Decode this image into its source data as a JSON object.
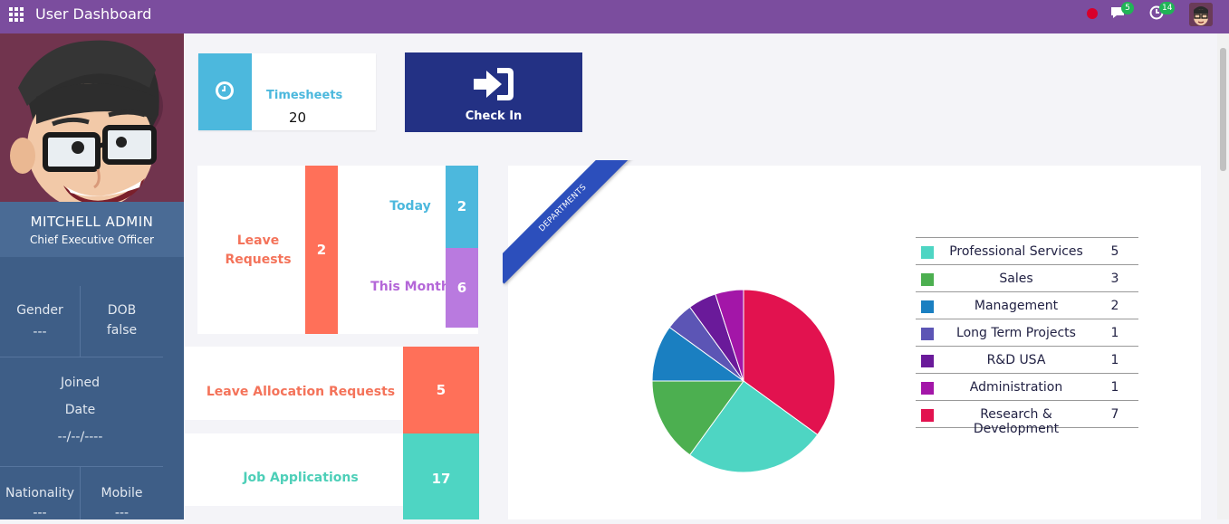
{
  "app": {
    "title": "User Dashboard"
  },
  "topbar": {
    "messages_count": "5",
    "activities_count": "14",
    "colors": {
      "background": "#7b4d9e",
      "badge": "#21b357",
      "status": "#d8002b"
    }
  },
  "profile": {
    "name": "MITCHELL ADMIN",
    "role": "Chief Executive Officer",
    "gender_label": "Gender",
    "gender_value": "---",
    "dob_label": "DOB",
    "dob_value": "false",
    "joined_label": "Joined",
    "date_label": "Date",
    "joined_value": "--/--/----",
    "nationality_label": "Nationality",
    "nationality_value": "---",
    "mobile_label": "Mobile",
    "mobile_value": "---"
  },
  "timesheets": {
    "label": "Timesheets",
    "value": "20"
  },
  "checkin": {
    "label": "Check In"
  },
  "leave_requests": {
    "label": "Leave Requests",
    "value": "2",
    "today_label": "Today",
    "today_value": "2",
    "month_label": "This Month",
    "month_value": "6"
  },
  "allocation": {
    "label": "Leave Allocation Requests",
    "value": "5"
  },
  "jobs": {
    "label": "Job Applications",
    "value": "17"
  },
  "departments": {
    "ribbon_label": "DEPARTMENTS"
  },
  "chart_data": {
    "type": "pie",
    "title": "",
    "categories": [
      "Professional Services",
      "Sales",
      "Management",
      "Long Term Projects",
      "R&D USA",
      "Administration",
      "Research & Development"
    ],
    "values": [
      5,
      3,
      2,
      1,
      1,
      1,
      7
    ],
    "colors": [
      "#4ed5c3",
      "#4caf50",
      "#1a7fc1",
      "#5c55b5",
      "#6a1a9a",
      "#a316a8",
      "#e2124f"
    ],
    "legend": "right"
  }
}
